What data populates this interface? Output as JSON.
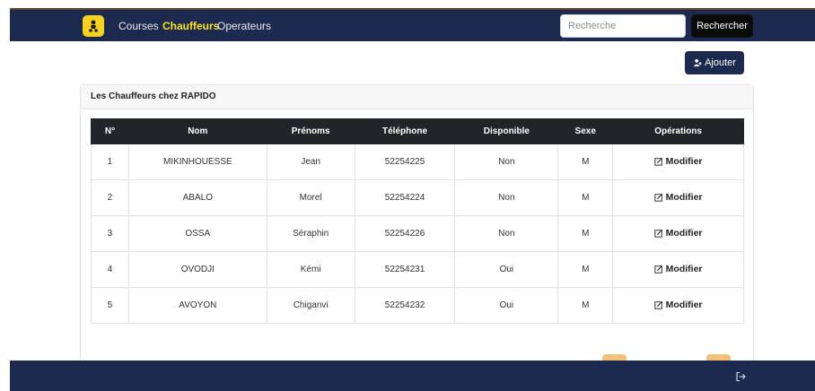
{
  "navbar": {
    "links": [
      {
        "label": "Courses",
        "active": false
      },
      {
        "label": "Chauffeurs",
        "active": true
      },
      {
        "label": "Operateurs",
        "active": false
      }
    ],
    "search_placeholder": "Recherche",
    "search_button": "Rechercher",
    "logo_icon": "scooter-icon"
  },
  "toolbar": {
    "add_label": "Ajouter",
    "add_icon": "user-plus-icon"
  },
  "card": {
    "title": "Les Chauffeurs chez RAPIDO"
  },
  "table": {
    "headers": [
      "N°",
      "Nom",
      "Prénoms",
      "Téléphone",
      "Disponible",
      "Sexe",
      "Opérations"
    ],
    "edit_label": "Modifier",
    "rows": [
      {
        "num": "1",
        "nom": "MIKINHOUESSE",
        "prenoms": "Jean",
        "telephone": "52254225",
        "disponible": "Non",
        "sexe": "M"
      },
      {
        "num": "2",
        "nom": "ABALO",
        "prenoms": "Morel",
        "telephone": "52254224",
        "disponible": "Non",
        "sexe": "M"
      },
      {
        "num": "3",
        "nom": "OSSA",
        "prenoms": "Séraphin",
        "telephone": "52254226",
        "disponible": "Non",
        "sexe": "M"
      },
      {
        "num": "4",
        "nom": "OVODJI",
        "prenoms": "Kémi",
        "telephone": "52254231",
        "disponible": "Oui",
        "sexe": "M"
      },
      {
        "num": "5",
        "nom": "AVOYON",
        "prenoms": "Chiganvi",
        "telephone": "52254232",
        "disponible": "Oui",
        "sexe": "M"
      }
    ]
  },
  "colors": {
    "navy": "#1b2a4e",
    "accent_yellow": "#f9e21d",
    "pagination_orange": "#f3c079"
  },
  "footer": {
    "logout_icon": "logout-icon"
  }
}
